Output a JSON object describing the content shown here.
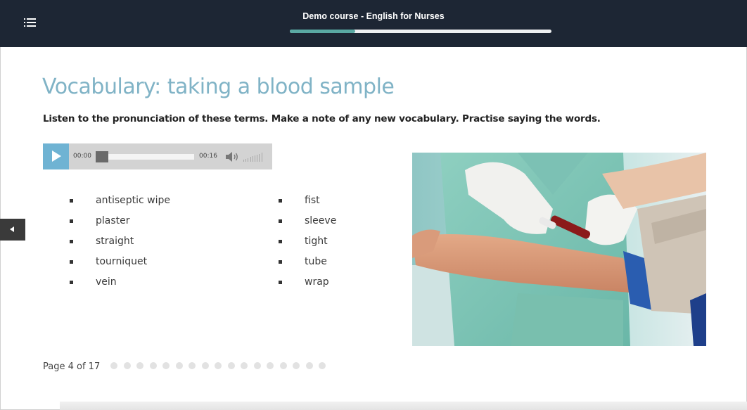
{
  "header": {
    "course_title": "Demo course - English for Nurses",
    "progress_fraction": 0.25,
    "progress_color": "#5aa9a3"
  },
  "page": {
    "title": "Vocabulary: taking a blood sample",
    "instructions": "Listen to the pronunciation of these terms. Make a note of any new vocabulary. Practise saying the words."
  },
  "audio": {
    "current_time": "00:00",
    "duration": "00:16",
    "play_icon": "play-icon",
    "volume_icon": "speaker-icon"
  },
  "vocabulary": {
    "column1": [
      "antiseptic wipe",
      "plaster",
      "straight",
      "tourniquet",
      "vein"
    ],
    "column2": [
      "fist",
      "sleeve",
      "tight",
      "tube",
      "wrap"
    ]
  },
  "image": {
    "subject": "gloved hands holding a blood sample tube next to a patient's arm with a blue tourniquet"
  },
  "pagination": {
    "label": "Page 4 of 17",
    "current": 4,
    "total": 17
  },
  "colors": {
    "topbar": "#1d2634",
    "title": "#80b3c6",
    "play_button": "#6fb3d3"
  }
}
